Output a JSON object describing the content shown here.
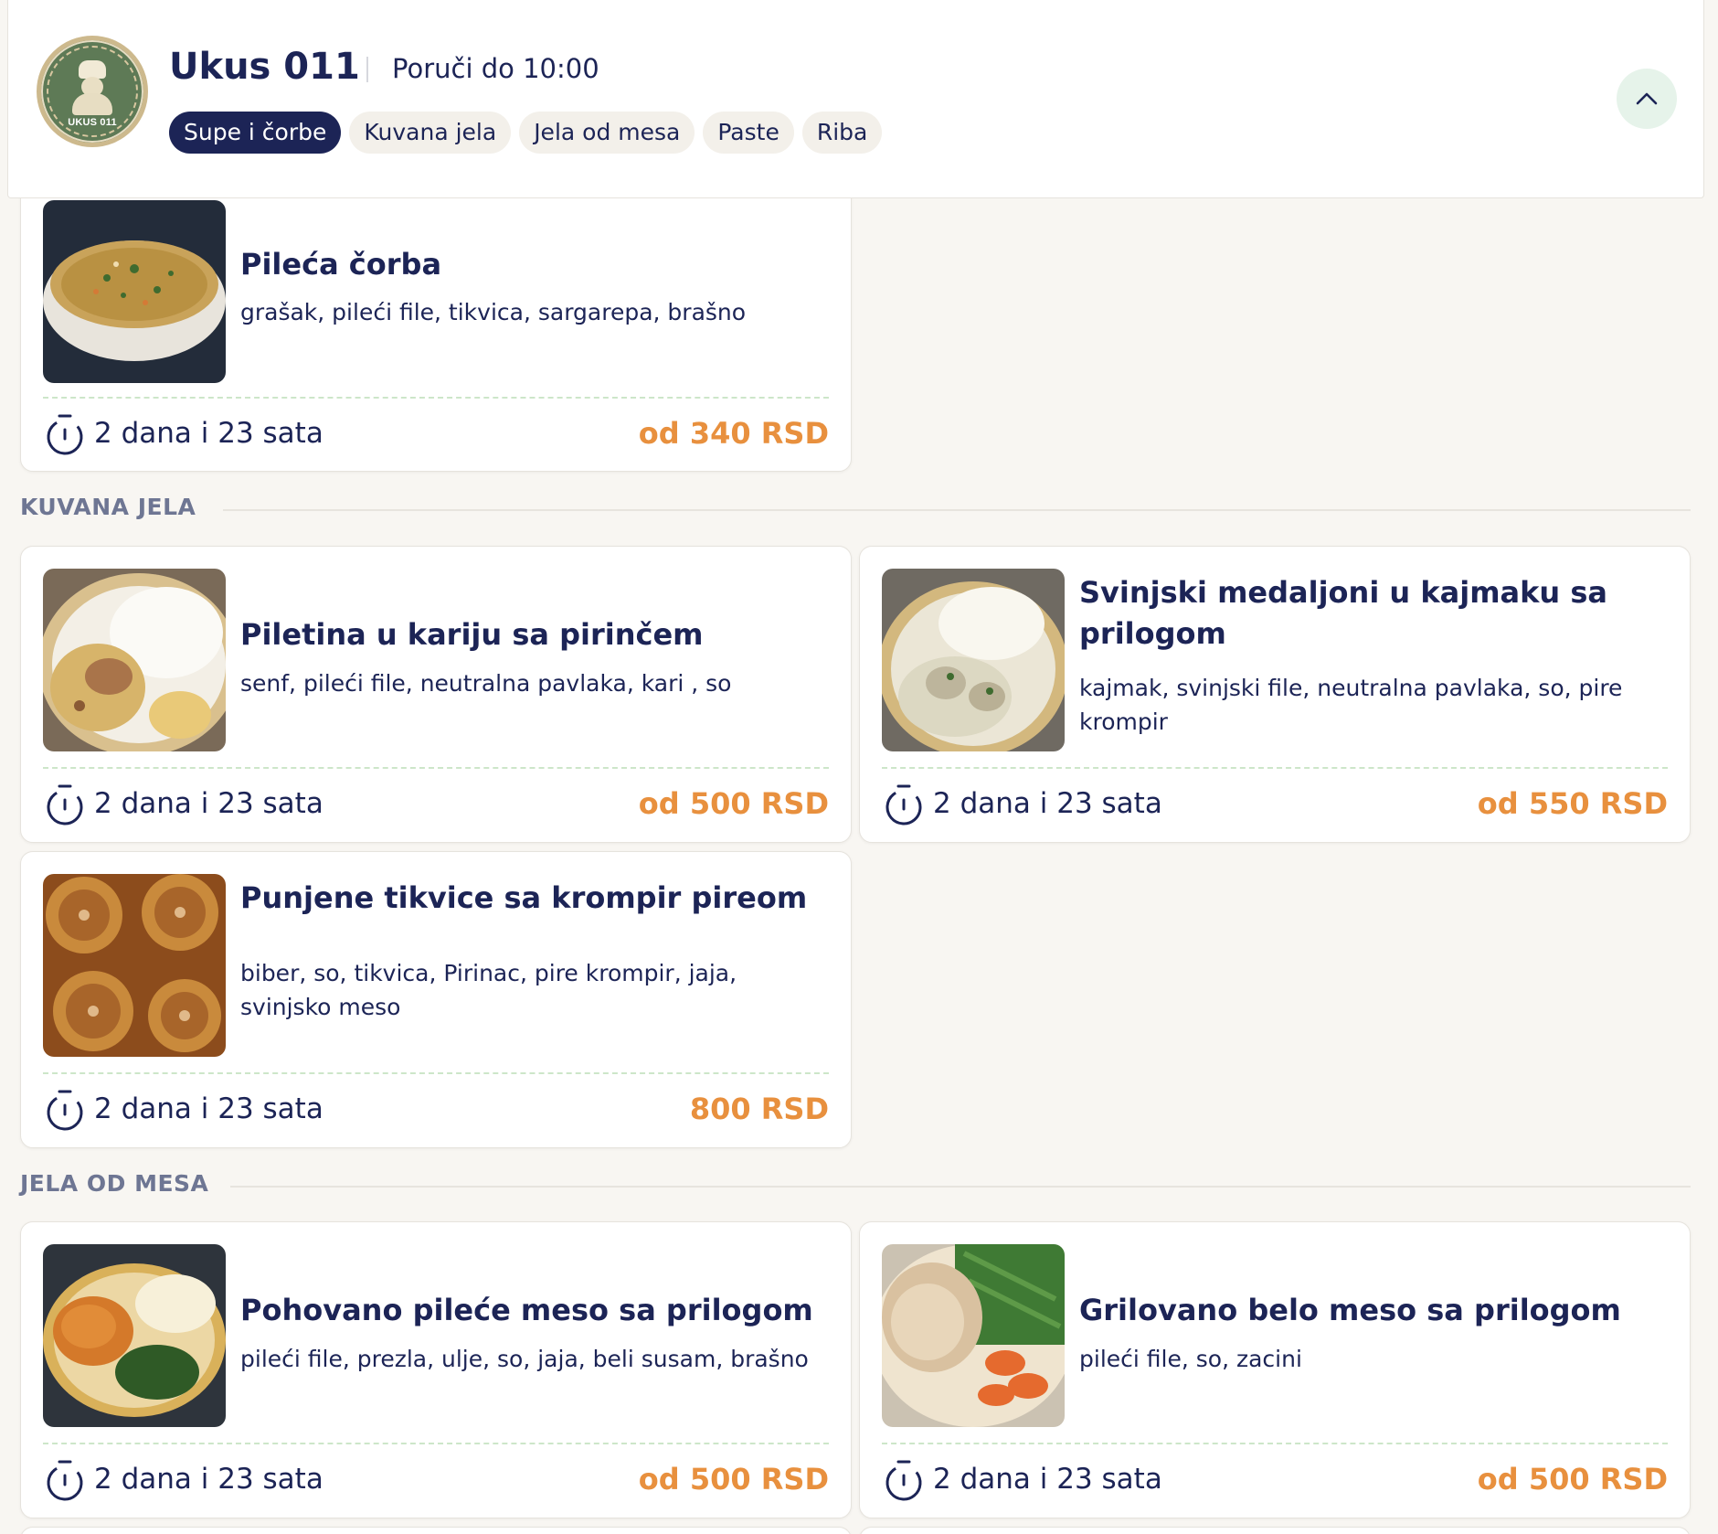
{
  "header": {
    "logo_text": "UKUS 011",
    "brand": "Ukus 011",
    "deadline": "Poruči do 10:00",
    "tabs": [
      {
        "label": "Supe i čorbe",
        "active": true
      },
      {
        "label": "Kuvana jela",
        "active": false
      },
      {
        "label": "Jela od mesa",
        "active": false
      },
      {
        "label": "Paste",
        "active": false
      },
      {
        "label": "Riba",
        "active": false
      }
    ],
    "collapse_icon": "chevron-up-icon"
  },
  "sections": {
    "kuvana": {
      "title": "KUVANA JELA"
    },
    "meso": {
      "title": "JELA OD MESA"
    }
  },
  "items": [
    {
      "name": "Pileća čorba",
      "ingredients": "grašak, pileći file, tikvica, sargarepa, brašno",
      "time": "2 dana i 23 sata",
      "price": "od 340 RSD",
      "image": "chicken-soup"
    },
    {
      "name": "Piletina u kariju sa pirinčem",
      "ingredients": "senf, pileći file, neutralna pavlaka, kari , so",
      "time": "2 dana i 23 sata",
      "price": "od 500 RSD",
      "image": "chicken-curry-rice"
    },
    {
      "name": "Svinjski medaljoni u kajmaku sa prilogom",
      "ingredients": "kajmak, svinjski file, neutralna pavlaka, so, pire krompir",
      "time": "2 dana i 23 sata",
      "price": "od 550 RSD",
      "image": "pork-medallions"
    },
    {
      "name": "Punjene tikvice sa krompir pireom",
      "ingredients": "biber, so, tikvica, Pirinac, pire krompir, jaja, svinjsko meso",
      "time": "2 dana i 23 sata",
      "price": "800 RSD",
      "image": "stuffed-zucchini"
    },
    {
      "name": "Pohovano pileće meso sa prilogom",
      "ingredients": "pileći file, prezla, ulje, so, jaja, beli susam, brašno",
      "time": "2 dana i 23 sata",
      "price": "od 500 RSD",
      "image": "breaded-chicken"
    },
    {
      "name": "Grilovano belo meso sa prilogom",
      "ingredients": "pileći file, so, zacini",
      "time": "2 dana i 23 sata",
      "price": "od 500 RSD",
      "image": "grilled-chicken"
    }
  ],
  "colors": {
    "navy": "#1c2456",
    "price": "#e8903e",
    "dash": "#cde6c9",
    "chip": "#f3f0ea",
    "collapse_bg": "#e6f3ea"
  }
}
